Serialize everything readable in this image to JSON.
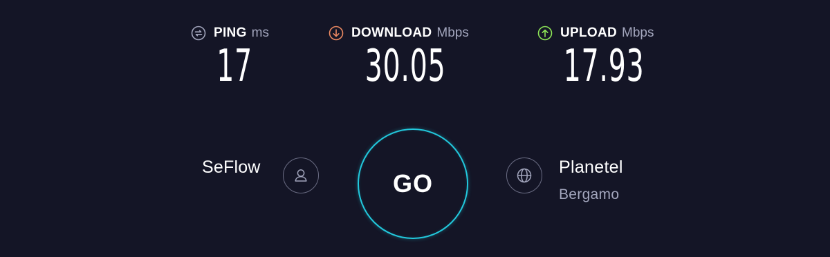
{
  "metrics": {
    "ping": {
      "label": "PING",
      "unit": "ms",
      "value": "17",
      "icon": "ping-icon",
      "icon_color": "#a3a6bd"
    },
    "download": {
      "label": "DOWNLOAD",
      "unit": "Mbps",
      "value": "30.05",
      "icon": "download-arrow-icon",
      "icon_color": "#ee8a62"
    },
    "upload": {
      "label": "UPLOAD",
      "unit": "Mbps",
      "value": "17.93",
      "icon": "upload-arrow-icon",
      "icon_color": "#8ee657"
    }
  },
  "provider": {
    "isp_name": "SeFlow",
    "icon": "user-icon"
  },
  "go_button": {
    "label": "GO",
    "ring_color": "#22c9dd"
  },
  "server": {
    "name": "Planetel",
    "location": "Bergamo",
    "icon": "globe-icon"
  },
  "colors": {
    "background": "#141526",
    "text": "#ffffff",
    "muted": "#a3a6bd"
  }
}
